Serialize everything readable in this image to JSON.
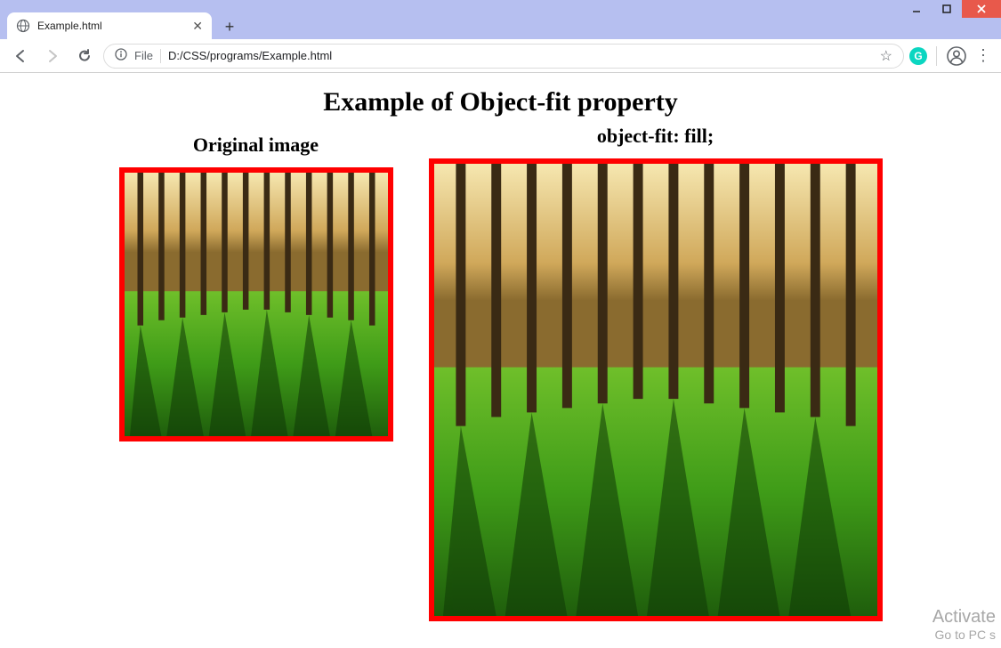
{
  "window": {
    "minimize_tooltip": "Minimize",
    "maximize_tooltip": "Maximize",
    "close_tooltip": "Close"
  },
  "tab": {
    "title": "Example.html"
  },
  "toolbar": {
    "file_label": "File",
    "url_path": "D:/CSS/programs/Example.html",
    "extension_letter": "G"
  },
  "page": {
    "title": "Example of Object-fit property",
    "left_heading": "Original image",
    "right_heading": "object-fit: fill;"
  },
  "watermark": {
    "line1": "Activate",
    "line2": "Go to PC s"
  }
}
